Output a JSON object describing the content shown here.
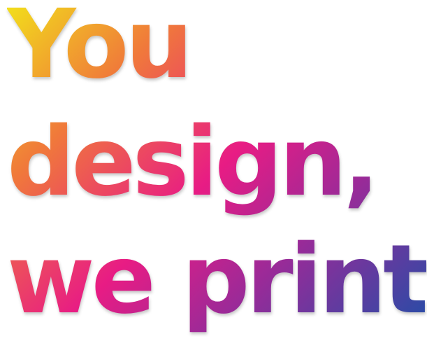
{
  "headline": {
    "lines": [
      "You",
      "design,",
      "we print"
    ]
  },
  "colors": {
    "gradient_start": "#f2e21a",
    "gradient_orange": "#f07a3a",
    "gradient_magenta": "#e81c84",
    "gradient_purple": "#9b2a98",
    "gradient_end": "#1d4fa8",
    "background": "#ffffff"
  }
}
